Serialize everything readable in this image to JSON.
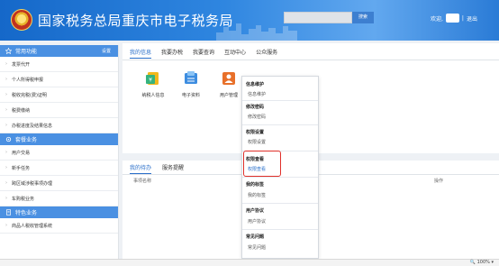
{
  "header": {
    "site_title": "国家税务总局重庆市电子税务局",
    "search_button": "搜索",
    "welcome": "欢迎,",
    "separator": "|",
    "logout": "退出"
  },
  "sidebar": {
    "sections": [
      {
        "title": "常用功能",
        "settings": "设置",
        "items": [
          "发票代开",
          "个人所得税申报",
          "税收完税(费)证明",
          "税费缴纳",
          "办税进度及结果信息"
        ]
      },
      {
        "title": "套餐业务",
        "items": [
          "用户交易",
          "新手任务",
          "跨区域涉税事项办理",
          "车购税业务"
        ]
      },
      {
        "title": "特色业务",
        "items": [
          "商品人税收管理系统"
        ]
      }
    ]
  },
  "main": {
    "top_tabs": [
      "我的信息",
      "我要办税",
      "我要查询",
      "互动中心",
      "公众服务"
    ],
    "apps": [
      "纳税人信息",
      "电子资料",
      "用户管理"
    ],
    "bottom_tabs": [
      "我的待办",
      "服务提醒"
    ],
    "columns": {
      "name": "事项名称",
      "action": "操作"
    }
  },
  "dropdown": {
    "groups": [
      {
        "title": "信息维护",
        "item": "信息维护"
      },
      {
        "title": "修改密码",
        "item": "修改密码"
      },
      {
        "title": "权限设置",
        "item": "权限设置"
      },
      {
        "title": "权限查看",
        "item": "权限查看"
      },
      {
        "title": "我的标签",
        "item": "我的标签"
      },
      {
        "title": "用户协议",
        "item": "用户协议"
      },
      {
        "title": "常见问题",
        "item": "常见问题"
      }
    ]
  },
  "statusbar": {
    "zoom": "100%"
  },
  "colors": {
    "primary": "#2a6fca",
    "sidebar_head": "#4a90e2",
    "highlight": "#e0302a"
  }
}
